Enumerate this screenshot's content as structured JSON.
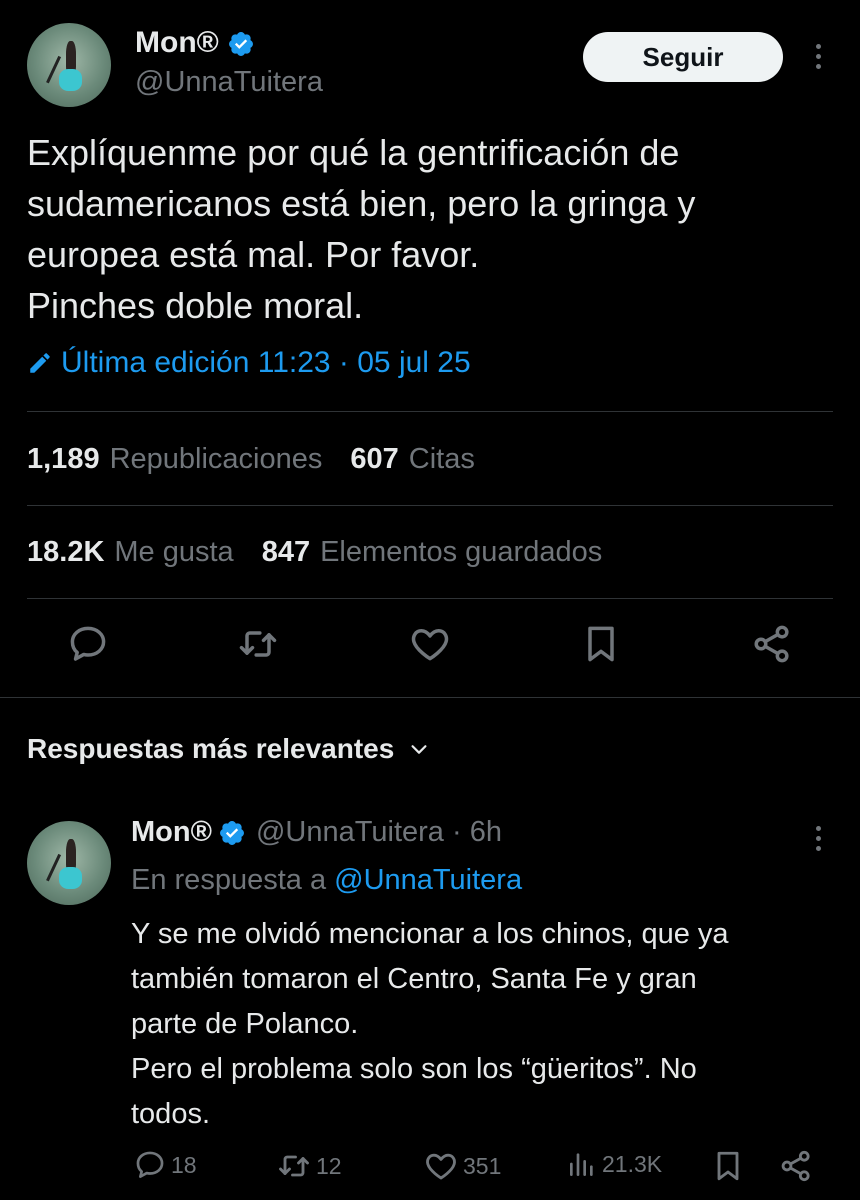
{
  "tweet": {
    "author_name": "Mon®",
    "author_handle": "@UnnaTuitera",
    "follow_label": "Seguir",
    "text": "Explíquenme por qué la gentrificación de\nsudamericanos está bien, pero la gringa y\neuropea está mal. Por favor.\nPinches doble moral.",
    "edit_label": "Última edición 11:23 · 05 jul 25",
    "reposts_count": "1,189",
    "reposts_label": "Republicaciones",
    "quotes_count": "607",
    "quotes_label": "Citas",
    "likes_count": "18.2K",
    "likes_label": "Me gusta",
    "bookmarks_count": "847",
    "bookmarks_label": "Elementos guardados"
  },
  "replies_section": {
    "title": "Respuestas más relevantes"
  },
  "reply": {
    "author_name": "Mon®",
    "handle_time": "@UnnaTuitera · 6h",
    "reply_to_prefix": "En respuesta a",
    "reply_to_mention": "@UnnaTuitera",
    "text": "Y se me olvidó mencionar a los chinos, que ya\ntambién tomaron el Centro, Santa Fe y gran\nparte de Polanco.\nPero el problema solo son los “güeritos”. No\ntodos.",
    "reply_count": "18",
    "repost_count": "12",
    "like_count": "351",
    "views_count": "21.3K"
  },
  "colors": {
    "background": "#000000",
    "text": "#e7e9ea",
    "muted": "#71767b",
    "accent": "#1d9bf0",
    "divider": "#2f3336"
  },
  "icons": [
    "verified-badge-icon",
    "more-icon",
    "edit-pencil-icon",
    "reply-icon",
    "repost-icon",
    "like-icon",
    "bookmark-icon",
    "share-icon",
    "chevron-down-icon",
    "views-icon"
  ]
}
